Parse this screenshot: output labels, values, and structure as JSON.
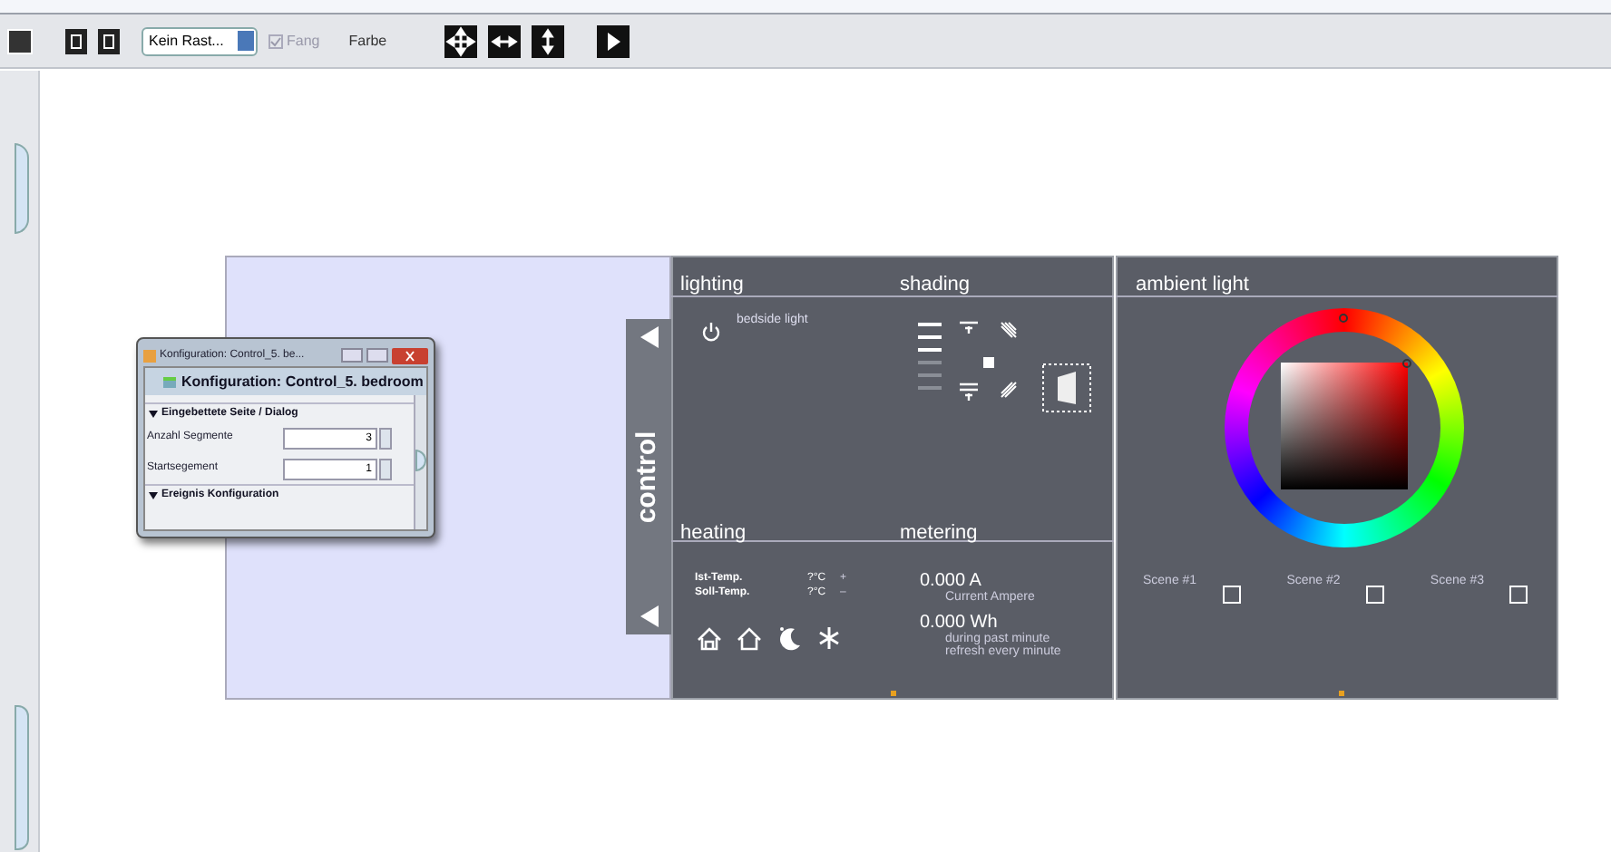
{
  "toolbar": {
    "raster_select": "Kein Rast...",
    "snap": {
      "label": "Fang",
      "checked": true,
      "disabled": true
    },
    "color_label": "Farbe"
  },
  "dialog": {
    "title": "Konfiguration: Control_5. be...",
    "header": "Konfiguration: Control_5. bedroom",
    "sections": [
      {
        "label": "Eingebettete Seite / Dialog",
        "expanded": true,
        "fields": [
          {
            "label": "Anzahl Segmente",
            "value": "3"
          },
          {
            "label": "Startsegement",
            "value": "1"
          }
        ]
      },
      {
        "label": "Ereignis Konfiguration",
        "expanded": true
      }
    ]
  },
  "control_tab": {
    "label": "control"
  },
  "lighting": {
    "title": "lighting",
    "items": [
      {
        "label": "bedside light"
      }
    ]
  },
  "shading": {
    "title": "shading",
    "level": 0.5
  },
  "heating": {
    "title": "heating",
    "rows": [
      {
        "label": "Ist-Temp.",
        "value": "?°C",
        "action": "+"
      },
      {
        "label": "Soll-Temp.",
        "value": "?°C",
        "action": "–"
      }
    ]
  },
  "metering": {
    "title": "metering",
    "readings": [
      {
        "value": "0.000 A",
        "captions": [
          "Current Ampere"
        ]
      },
      {
        "value": "0.000 Wh",
        "captions": [
          "during past minute",
          "refresh every minute"
        ]
      }
    ]
  },
  "ambient": {
    "title": "ambient light",
    "scenes": [
      {
        "label": "Scene #1",
        "checked": false
      },
      {
        "label": "Scene #2",
        "checked": false
      },
      {
        "label": "Scene #3",
        "checked": false
      }
    ]
  }
}
